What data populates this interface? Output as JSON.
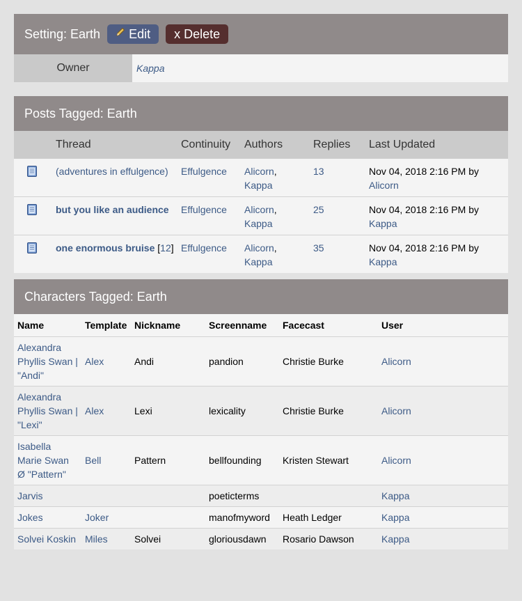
{
  "setting": {
    "title": "Setting: Earth",
    "edit_label": "Edit",
    "delete_label": "x Delete",
    "owner_label": "Owner",
    "owner_value": "Kappa"
  },
  "posts": {
    "title": "Posts Tagged: Earth",
    "columns": [
      "Thread",
      "Continuity",
      "Authors",
      "Replies",
      "Last Updated"
    ],
    "rows": [
      {
        "thread": "(adventures in effulgence)",
        "bold": false,
        "pages_prefix": "",
        "pages": [],
        "pages_suffix": "",
        "continuity": "Effulgence",
        "author1": "Alicorn",
        "author2": "Kappa",
        "replies": "13",
        "updated": "Nov 04, 2018 2:16 PM by",
        "updated_by": "Alicorn"
      },
      {
        "thread": "but you like an audience",
        "bold": true,
        "pages_prefix": "",
        "pages": [],
        "pages_suffix": "",
        "continuity": "Effulgence",
        "author1": "Alicorn",
        "author2": "Kappa",
        "replies": "25",
        "updated": "Nov 04, 2018 2:16 PM by",
        "updated_by": "Kappa"
      },
      {
        "thread": "one enormous bruise",
        "bold": true,
        "pages_prefix": "[",
        "pages": [
          "1",
          "2"
        ],
        "pages_suffix": "]",
        "continuity": "Effulgence",
        "author1": "Alicorn",
        "author2": "Kappa",
        "replies": "35",
        "updated": "Nov 04, 2018 2:16 PM by",
        "updated_by": "Kappa"
      }
    ]
  },
  "characters": {
    "title": "Characters Tagged: Earth",
    "columns": [
      "Name",
      "Template",
      "Nickname",
      "Screenname",
      "Facecast",
      "User"
    ],
    "rows": [
      {
        "name": "Alexandra Phyllis Swan | \"Andi\"",
        "template": "Alex",
        "nickname": "Andi",
        "screenname": "pandion",
        "facecast": "Christie Burke",
        "user": "Alicorn"
      },
      {
        "name": "Alexandra Phyllis Swan | \"Lexi\"",
        "template": "Alex",
        "nickname": "Lexi",
        "screenname": "lexicality",
        "facecast": "Christie Burke",
        "user": "Alicorn"
      },
      {
        "name": "Isabella Marie Swan Ø \"Pattern\"",
        "template": "Bell",
        "nickname": "Pattern",
        "screenname": "bellfounding",
        "facecast": "Kristen Stewart",
        "user": "Alicorn"
      },
      {
        "name": "Jarvis",
        "template": "",
        "nickname": "",
        "screenname": "poeticterms",
        "facecast": "",
        "user": "Kappa"
      },
      {
        "name": "Jokes",
        "template": "Joker",
        "nickname": "",
        "screenname": "manofmyword",
        "facecast": "Heath Ledger",
        "user": "Kappa"
      },
      {
        "name": "Solvei Koskin",
        "template": "Miles",
        "nickname": "Solvei",
        "screenname": "gloriousdawn",
        "facecast": "Rosario Dawson",
        "user": "Kappa"
      }
    ]
  },
  "icons": {
    "edit": "pencil-icon",
    "thread": "document-icon"
  }
}
